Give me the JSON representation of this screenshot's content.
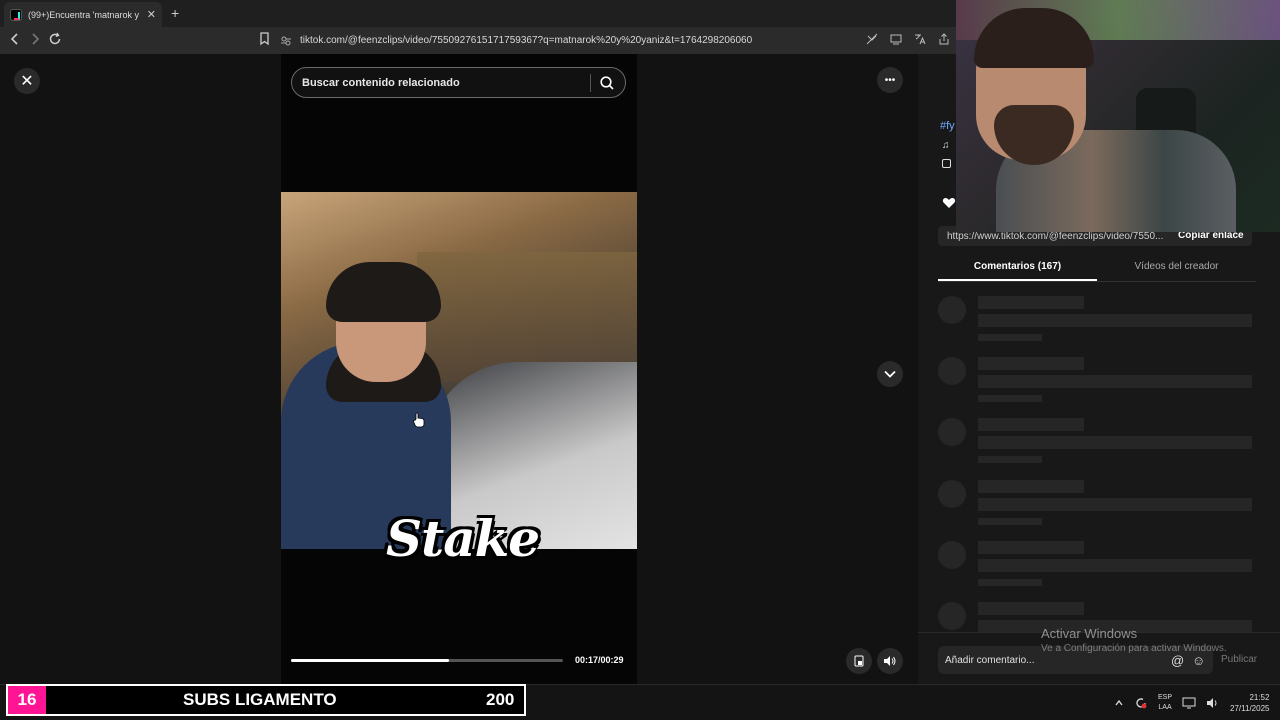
{
  "browser": {
    "tab_title": "(99+)Encuentra 'matnarok y y",
    "tab_close": "✕",
    "new_tab": "+",
    "url": "tiktok.com/@feenzclips/video/7550927615171759367?q=matnarok%20y%20yaniz&t=1764298206060"
  },
  "viewer": {
    "close_glyph": "✕",
    "search_placeholder": "Buscar contenido relacionado",
    "more_glyph": "•••",
    "down_glyph": "⌄",
    "watermark": "Stake",
    "time": "00:17/00:29",
    "progress": 0.58
  },
  "panel": {
    "copy_url": "https://www.tiktok.com/@feenzclips/video/7550...",
    "copy_link_label": "Copiar enlace",
    "tabs": [
      "Comentarios (167)",
      "Vídeos del creador"
    ],
    "comment_placeholder": "Añadir comentario...",
    "publish_label": "Publicar",
    "mention_glyph": "@",
    "emoji_glyph": "☺"
  },
  "partial_labels": {
    "hashtag": "#fy",
    "music": "♫"
  },
  "watermark_windows": {
    "line1": "Activar Windows",
    "line2": "Ve a Configuración para activar Windows."
  },
  "overlay": {
    "subs_count": "16",
    "subs_label": "SUBS LIGAMENTO",
    "subs_goal": "200"
  },
  "taskbar": {
    "lang_top": "ESP",
    "lang_bottom": "LAA",
    "time": "21:52",
    "date": "27/11/2025"
  },
  "colors": {
    "accent_pink": "#ff1493",
    "background": "#121212"
  }
}
